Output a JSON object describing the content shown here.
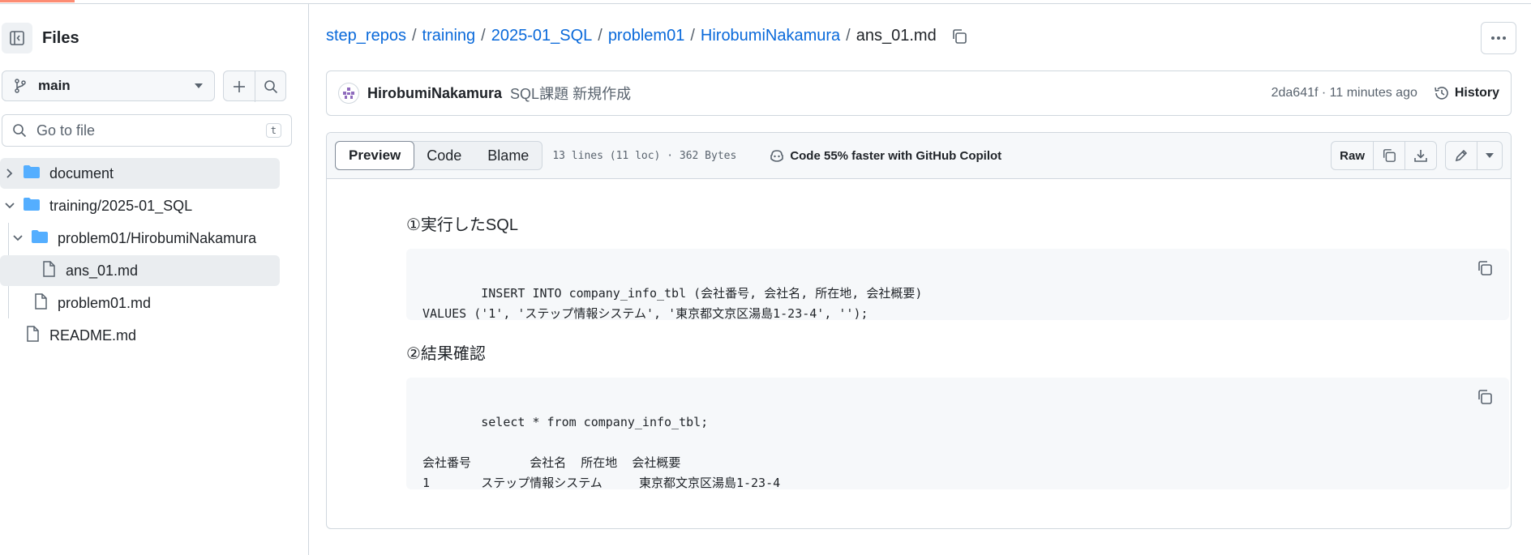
{
  "colors": {
    "accent": "#0969da",
    "progress": "#fd8c73",
    "border": "#d0d7de",
    "muted": "#59636e"
  },
  "sidebar": {
    "title": "Files",
    "branch": "main",
    "goto_placeholder": "Go to file",
    "goto_shortcut": "t",
    "tree": [
      {
        "label": "document",
        "type": "folder",
        "expanded": false
      },
      {
        "label": "training/2025-01_SQL",
        "type": "folder",
        "expanded": true
      },
      {
        "label": "problem01/HirobumiNakamura",
        "type": "folder",
        "expanded": true
      },
      {
        "label": "ans_01.md",
        "type": "file",
        "selected": true
      },
      {
        "label": "problem01.md",
        "type": "file"
      },
      {
        "label": "README.md",
        "type": "file"
      }
    ]
  },
  "breadcrumb": {
    "parts": [
      "step_repos",
      "training",
      "2025-01_SQL",
      "problem01",
      "HirobumiNakamura"
    ],
    "separator": "/",
    "current": "ans_01.md"
  },
  "commit": {
    "author": "HirobumiNakamura",
    "message": "SQL課題 新規作成",
    "meta": "2da641f · 11 minutes ago",
    "history_label": "History"
  },
  "file_header": {
    "tabs": [
      "Preview",
      "Code",
      "Blame"
    ],
    "active_tab": "Preview",
    "info": "13 lines (11 loc) · 362 Bytes",
    "copilot": "Code 55% faster with GitHub Copilot",
    "raw_label": "Raw"
  },
  "content": {
    "heading1": "①実行したSQL",
    "code1": "INSERT INTO company_info_tbl (会社番号, 会社名, 所在地, 会社概要)\nVALUES ('1', 'ステップ情報システム', '東京都文京区湯島1-23-4', '');",
    "heading2": "②結果確認",
    "code2": "select * from company_info_tbl;\n\n会社番号        会社名  所在地  会社概要\n1       ステップ情報システム     東京都文京区湯島1-23-4"
  }
}
